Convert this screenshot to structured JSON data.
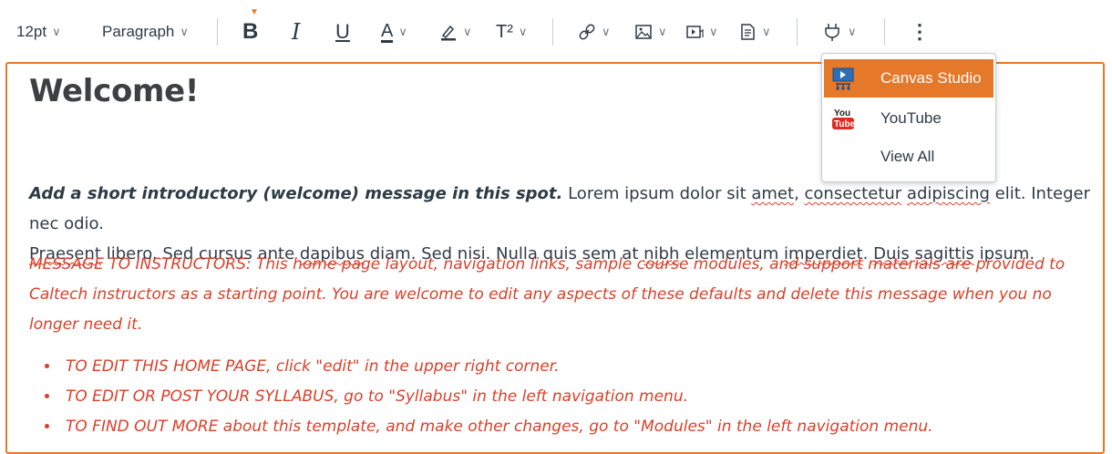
{
  "toolbar": {
    "font_size": "12pt",
    "block_format": "Paragraph",
    "bold": "B",
    "italic": "I",
    "underline": "U",
    "text_color": "A",
    "superscript": "T²",
    "more": "⋮"
  },
  "menu": {
    "items": [
      {
        "label": "Canvas Studio",
        "icon": "canvas-studio-icon"
      },
      {
        "label": "YouTube",
        "icon": "youtube-icon"
      },
      {
        "label": "View All"
      }
    ]
  },
  "content": {
    "heading": "Welcome!",
    "intro_bold": "Add a short introductory (welcome) message in this spot.",
    "intro_line1_a": " Lorem ipsum dolor sit ",
    "intro_w1": "amet",
    "intro_line1_b": ", ",
    "intro_w2": "consectetur",
    "intro_line1_c": " ",
    "intro_w3": "adipiscing",
    "intro_line1_d": " elit. Integer nec odio.",
    "intro_w4": "Praesent",
    "intro_line2_a": " libero. Sed cursus ante ",
    "intro_w5": "dapibus",
    "intro_line2_b": " diam. Sed nisi. Nulla quis sem at ",
    "intro_w6": "nibh",
    "intro_line2_c": " elementum ",
    "intro_w7": "imperdiet",
    "intro_line2_d": ". ",
    "intro_w8": "Duis",
    "intro_line2_e": " ",
    "intro_w9": "sagittis",
    "intro_line2_f": " ipsum.",
    "message": "MESSAGE TO INSTRUCTORS: This home page layout, navigation links, sample course modules, and support materials are provided to Caltech instructors as a starting point. You are welcome to edit any aspects of these defaults and delete this message when you no longer need it.",
    "bullets": [
      "TO EDIT THIS HOME PAGE, click \"edit\" in the upper right corner.",
      "TO EDIT OR POST YOUR SYLLABUS, go to \"Syllabus\" in the left navigation menu.",
      "TO FIND OUT MORE about this template, and make other changes, go to \"Modules\" in the left navigation menu."
    ]
  },
  "colors": {
    "accent": "#e6782a",
    "message_red": "#d9402a",
    "text": "#2d3b45"
  }
}
